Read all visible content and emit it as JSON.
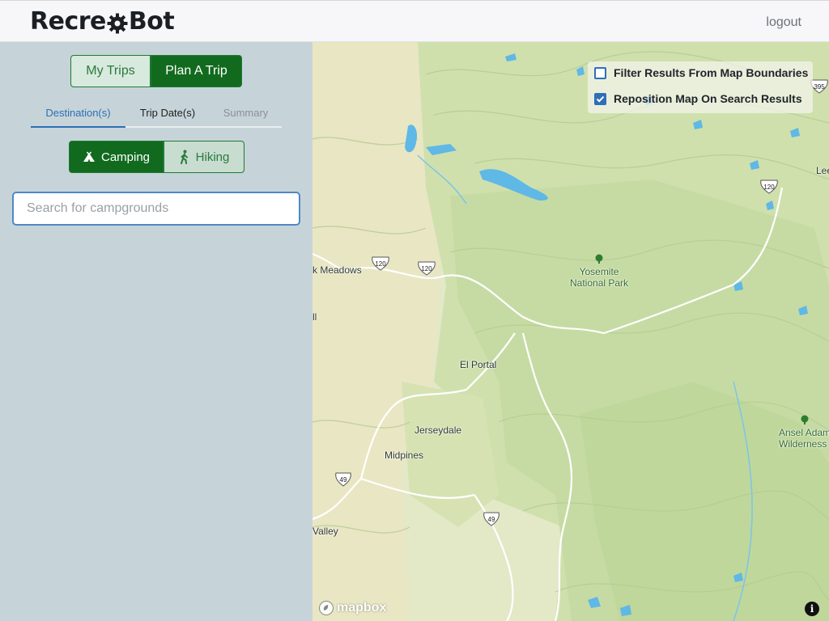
{
  "app": {
    "name_left": "Recre",
    "name_gear": "o",
    "name_right": "Bot",
    "logout_label": "logout"
  },
  "sidebar": {
    "trip_buttons": [
      {
        "label": "My Trips",
        "active": false
      },
      {
        "label": "Plan A Trip",
        "active": true
      }
    ],
    "tabs": [
      {
        "label": "Destination(s)",
        "active": true
      },
      {
        "label": "Trip Date(s)",
        "active": false
      },
      {
        "label": "Summary",
        "active": false
      }
    ],
    "activities": [
      {
        "label": "Camping",
        "icon": "tent-icon",
        "active": true
      },
      {
        "label": "Hiking",
        "icon": "hiker-icon",
        "active": false
      }
    ],
    "search": {
      "placeholder": "Search for campgrounds",
      "value": ""
    }
  },
  "map": {
    "filters": [
      {
        "label": "Filter Results From Map Boundaries",
        "checked": false
      },
      {
        "label": "Reposition Map On Search Results",
        "checked": true
      }
    ],
    "places": {
      "meadows": "k Meadows",
      "yosemite_1": "Yosemite",
      "yosemite_2": "National Park",
      "ll": "ll",
      "el_portal": "El Portal",
      "jerseydale": "Jerseydale",
      "midpines": "Midpines",
      "valley": "Valley",
      "ansel_1": "Ansel Adam",
      "ansel_2": "Wilderness",
      "lee": "Lee"
    },
    "shields": {
      "hwy120a": "120",
      "hwy120b": "120",
      "hwy120c": "120",
      "hwy49a": "49",
      "hwy49b": "49",
      "hwy395": "395"
    },
    "attribution": "mapbox",
    "info_label": "i",
    "colors": {
      "terrain": "#dfe7c4",
      "forest": "#c9deaa",
      "water": "#5fb8e6",
      "accent_green": "#126a1f",
      "accent_blue": "#2f6fb8"
    }
  }
}
